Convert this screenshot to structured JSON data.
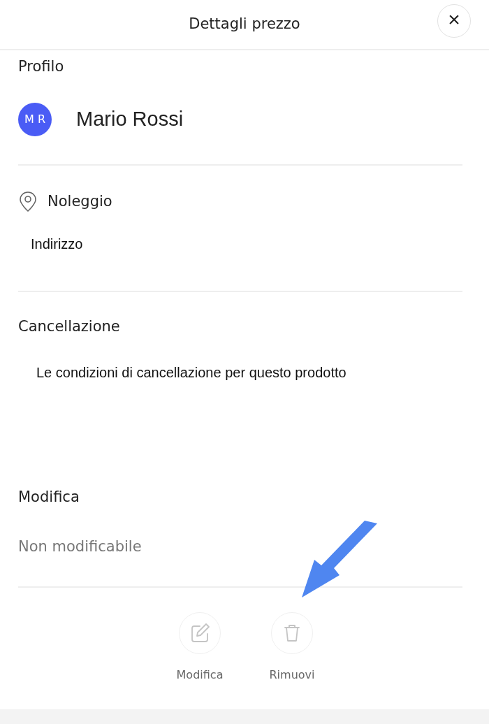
{
  "header": {
    "title": "Dettagli prezzo",
    "close_label": "×"
  },
  "profile": {
    "heading": "Profilo",
    "initials": "M R",
    "name": "Mario Rossi"
  },
  "rental": {
    "heading": "Noleggio",
    "address": "Indirizzo"
  },
  "cancellation": {
    "heading": "Cancellazione",
    "text": "Le condizioni di cancellazione per questo prodotto"
  },
  "edit": {
    "heading": "Modifica",
    "text": "Non modificabile"
  },
  "actions": [
    {
      "kind": "edit",
      "label": "Modifica",
      "disabled": true
    },
    {
      "kind": "delete",
      "label": "Rimuovi",
      "disabled": true
    }
  ]
}
